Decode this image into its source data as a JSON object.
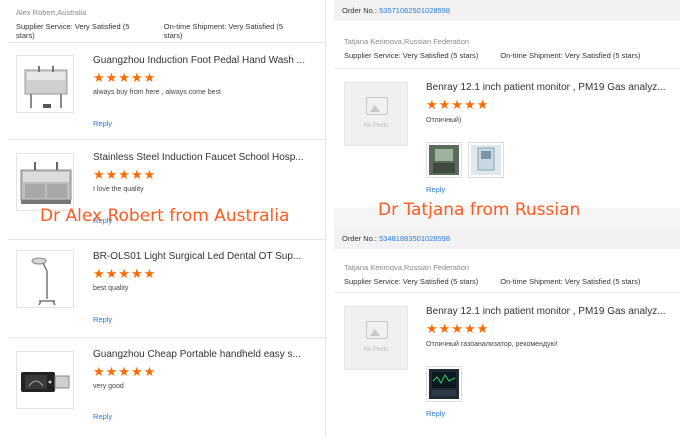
{
  "left": {
    "reviewer": "Alex Robert,Australia",
    "supplier_label": "Supplier Service:",
    "supplier_value": "Very Satisfied",
    "supplier_stars": "(5 stars)",
    "shipment_label": "On-time Shipment:",
    "shipment_value": "Very Satisfied",
    "shipment_stars": "(5 stars)",
    "reviews": [
      {
        "title": "Guangzhou Induction Foot Pedal Hand Wash ...",
        "rating": 5,
        "stars": "★★★★★",
        "comment": "always buy from here , always come best",
        "reply": "Reply",
        "image": "sink-icon"
      },
      {
        "title": "Stainless Steel Induction Faucet School Hosp...",
        "rating": 5,
        "stars": "★★★★★",
        "comment": "I love the quality",
        "reply": "Reply",
        "image": "steel-sink-icon"
      },
      {
        "title": "BR-OLS01 Light Surgical Led Dental OT Sup...",
        "rating": 5,
        "stars": "★★★★★",
        "comment": "best quality",
        "reply": "Reply",
        "image": "lamp-icon"
      },
      {
        "title": "Guangzhou Cheap Portable handheld easy s...",
        "rating": 5,
        "stars": "★★★★★",
        "comment": "very good",
        "reply": "Reply",
        "image": "ultrasound-icon"
      }
    ]
  },
  "right": {
    "orders": [
      {
        "order_label": "Order No.:",
        "order_no": "53571062501028598",
        "reviewer": "Tatjana Kerimova,Russian Federation",
        "supplier_label": "Supplier Service:",
        "supplier_value": "Very Satisfied",
        "supplier_stars": "(5 stars)",
        "shipment_label": "On-time Shipment:",
        "shipment_value": "Very Satisfied",
        "shipment_stars": "(5 stars)",
        "nophoto": "No Photo",
        "title": "Benray 12.1 inch patient monitor , PM19 Gas analyz...",
        "rating": 5,
        "stars": "★★★★★",
        "comment": "Отличный)",
        "reply": "Reply"
      },
      {
        "order_label": "Order No.:",
        "order_no": "53481883501028598",
        "reviewer": "Tatjana Kerimova,Russian Federation",
        "supplier_label": "Supplier Service:",
        "supplier_value": "Very Satisfied",
        "supplier_stars": "(5 stars)",
        "shipment_label": "On-time Shipment:",
        "shipment_value": "Very Satisfied",
        "shipment_stars": "(5 stars)",
        "nophoto": "No Photo",
        "title": "Benray 12.1 inch patient monitor , PM19 Gas analyz...",
        "rating": 5,
        "stars": "★★★★★",
        "comment": "Отличный газоанализатор, рекомендую!",
        "reply": "Reply"
      }
    ]
  },
  "overlays": {
    "left": "Dr Alex Robert from Australia",
    "right": "Dr Tatjana from Russian"
  },
  "colors": {
    "star": "#ff6a00",
    "link": "#2a7ae2",
    "overlay": "#ff5a1f"
  }
}
